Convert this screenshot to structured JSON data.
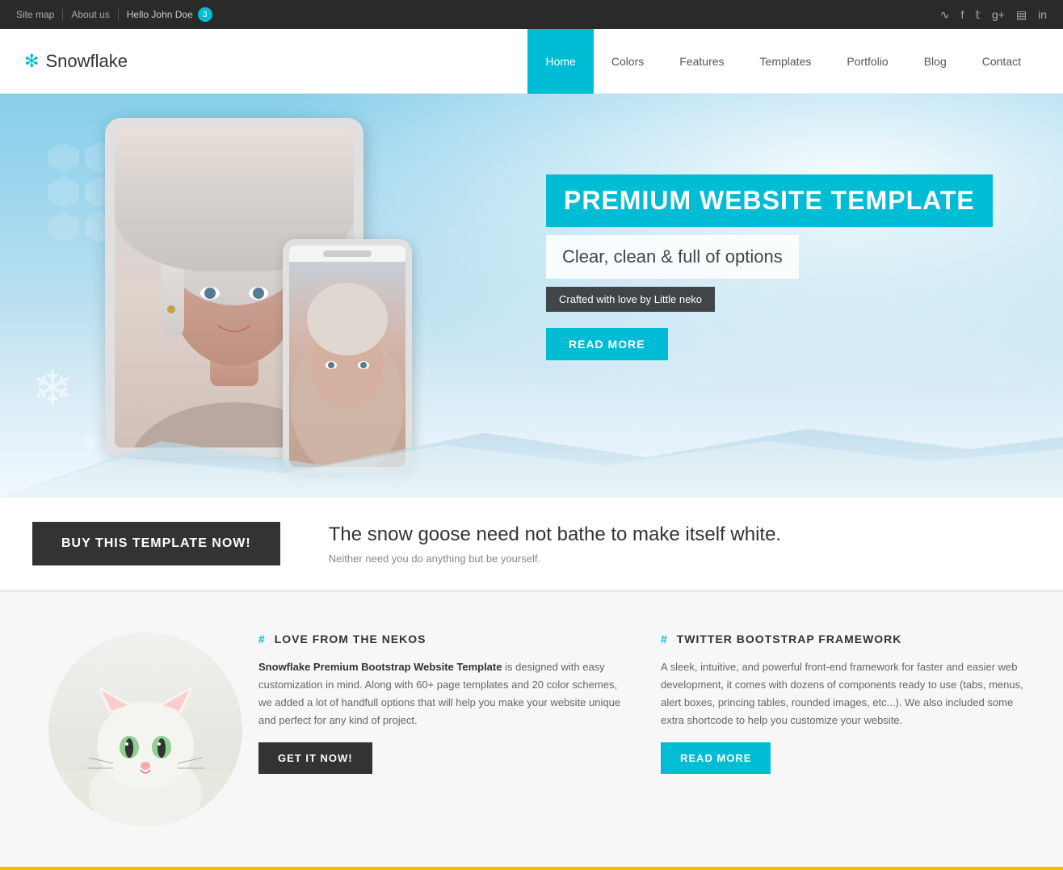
{
  "topbar": {
    "links": [
      "Site map",
      "About us"
    ],
    "user": "Hello John Doe",
    "badge": "3",
    "socials": [
      "rss",
      "facebook",
      "twitter",
      "google-plus",
      "instagram",
      "linkedin"
    ]
  },
  "nav": {
    "logo": "Snowflake",
    "links": [
      {
        "label": "Home",
        "active": true
      },
      {
        "label": "Colors",
        "active": false
      },
      {
        "label": "Features",
        "active": false
      },
      {
        "label": "Templates",
        "active": false
      },
      {
        "label": "Portfolio",
        "active": false
      },
      {
        "label": "Blog",
        "active": false
      },
      {
        "label": "Contact",
        "active": false
      }
    ]
  },
  "hero": {
    "title": "PREMIUM WEBSITE TEMPLATE",
    "subtitle": "Clear, clean & full of options",
    "credit": "Crafted with love by Little neko",
    "cta_button": "READ MORE"
  },
  "cta": {
    "buy_button": "BUY THIS TEMPLATE NOW!",
    "heading": "The snow goose need not bathe to make itself white.",
    "subtext": "Neither need you do anything but be yourself."
  },
  "features": {
    "col1": {
      "heading": "LOVE FROM THE NEKOS",
      "intro_bold": "Snowflake Premium Bootstrap Website Template",
      "intro_rest": " is designed with easy customization in mind. Along with 60+ page templates and 20 color schemes, we added a lot of handfull options that will help you make your website unique and perfect for any kind of project.",
      "button": "GET IT NOW!"
    },
    "col2": {
      "heading": "TWITTER BOOTSTRAP FRAMEWORK",
      "text": "A sleek, intuitive, and powerful front-end framework for faster and easier web development, it comes with dozens of components ready to use (tabs, menus, alert boxes, princing tables, rounded images, etc...). We also included some extra shortcode to help you customize your website.",
      "button": "READ MORE"
    }
  }
}
